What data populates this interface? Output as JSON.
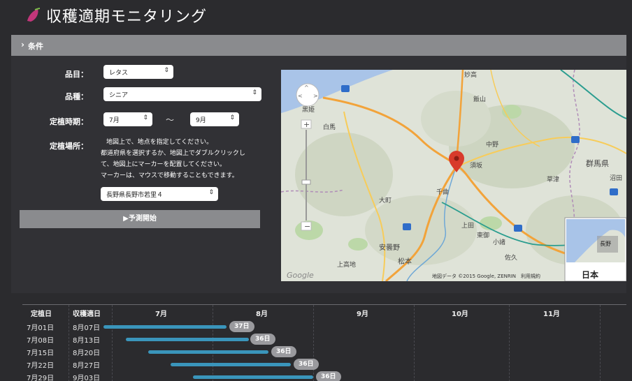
{
  "app": {
    "title": "収穫適期モニタリング"
  },
  "conditions": {
    "label": "条件"
  },
  "form": {
    "item_label": "品目：",
    "item_value": "レタス",
    "variety_label": "品種：",
    "variety_value": "シニア",
    "planting_label": "定植時期：",
    "from_month": "7月",
    "tilde": "〜",
    "to_month": "9月",
    "location_label": "定植場所：",
    "help_lines": [
      "地図上で、地点を指定してください。",
      "都道府県を選択するか、地図上でダブルクリックし",
      "て、地図上にマーカーを配置してください。",
      "マーカーは、マウスで移動することもできます。"
    ],
    "location_value": "長野県長野市若里４",
    "start_button": "▶予測開始"
  },
  "map": {
    "places": [
      "妙高",
      "飯山",
      "中野",
      "須坂",
      "千曲",
      "上田",
      "東御",
      "小諸",
      "佐久",
      "安曇野",
      "松本",
      "大町",
      "白馬",
      "黒姫",
      "群馬県",
      "沼田",
      "上高地",
      "草津",
      "長野"
    ],
    "inset_label": "日本",
    "attribution": "地図データ ©2015 Google, ZENRIN　利用規約",
    "google": "Google"
  },
  "timeline": {
    "headers": {
      "planting": "定植日",
      "harvest": "収穫適日"
    },
    "months": [
      "7月",
      "8月",
      "9月",
      "10月",
      "11月"
    ],
    "rows": [
      {
        "planting": "7月01日",
        "harvest": "8月07日",
        "days": "37日"
      },
      {
        "planting": "7月08日",
        "harvest": "8月13日",
        "days": "36日"
      },
      {
        "planting": "7月15日",
        "harvest": "8月20日",
        "days": "36日"
      },
      {
        "planting": "7月22日",
        "harvest": "8月27日",
        "days": "36日"
      },
      {
        "planting": "7月29日",
        "harvest": "9月03日",
        "days": "36日"
      }
    ]
  },
  "colors": {
    "accent_bar": "#3a95bb",
    "marker": "#d83a2b",
    "header_bar": "#8a8b8e"
  }
}
